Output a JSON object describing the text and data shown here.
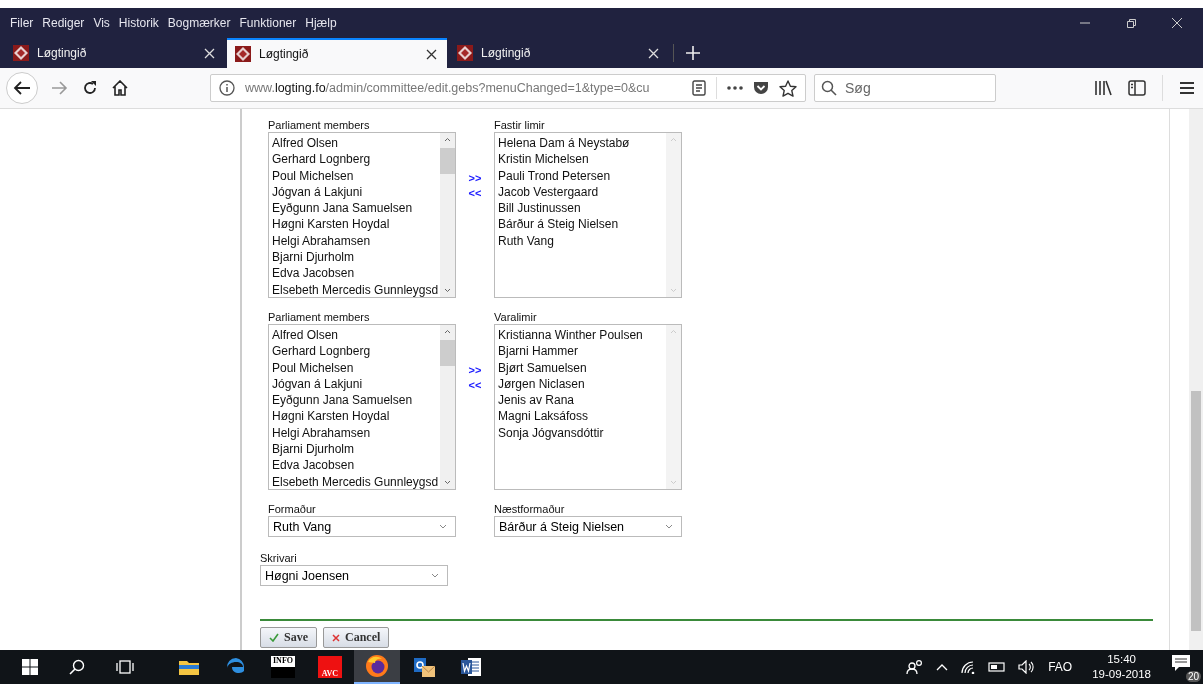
{
  "menu_bar": [
    "Filer",
    "Rediger",
    "Vis",
    "Historik",
    "Bogmærker",
    "Funktioner",
    "Hjælp"
  ],
  "tabs": [
    {
      "title": "Løgtingið",
      "selected": false
    },
    {
      "title": "Løgtingið",
      "selected": true
    },
    {
      "title": "Løgtingið",
      "selected": false
    }
  ],
  "address_bar": {
    "prefix": "www.",
    "domain": "logting.fo",
    "path": "/admin/committee/edit.gebs?menuChanged=1&type=0&cu"
  },
  "search": {
    "placeholder": "Søg"
  },
  "member_groups": [
    {
      "source_label": "Parliament members",
      "source_items": [
        "Alfred Olsen",
        "Gerhard Lognberg",
        "Poul Michelsen",
        "Jógvan á Lakjuni",
        "Eyðgunn Jana Samuelsen",
        "Høgni Karsten Hoydal",
        "Helgi Abrahamsen",
        "Bjarni Djurholm",
        "Edva Jacobsen",
        "Elsebeth Mercedis Gunnleygsd"
      ],
      "move_right": ">>",
      "move_left": "<<",
      "target_label": "Fastir limir",
      "target_items": [
        "Helena Dam á Neystabø",
        "Kristin Michelsen",
        "Pauli Trond Petersen",
        "Jacob Vestergaard",
        "Bill Justinussen",
        "Bárður á Steig Nielsen",
        "Ruth Vang"
      ]
    },
    {
      "source_label": "Parliament members",
      "source_items": [
        "Alfred Olsen",
        "Gerhard Lognberg",
        "Poul Michelsen",
        "Jógvan á Lakjuni",
        "Eyðgunn Jana Samuelsen",
        "Høgni Karsten Hoydal",
        "Helgi Abrahamsen",
        "Bjarni Djurholm",
        "Edva Jacobsen",
        "Elsebeth Mercedis Gunnleygsd"
      ],
      "move_right": ">>",
      "move_left": "<<",
      "target_label": "Varalimir",
      "target_items": [
        "Kristianna Winther Poulsen",
        "Bjarni Hammer",
        "Bjørt Samuelsen",
        "Jørgen Niclasen",
        "Jenis av Rana",
        "Magni Laksáfoss",
        "Sonja Jógvansdóttir"
      ]
    }
  ],
  "officer_selects": [
    {
      "label": "Formaður",
      "value": "Ruth Vang"
    },
    {
      "label": "Næstformaður",
      "value": "Bárður á Steig Nielsen"
    }
  ],
  "secretary_select": {
    "label": "Skrivari",
    "value": "Høgni Joensen"
  },
  "buttons": [
    {
      "kind": "save",
      "label": "Save"
    },
    {
      "kind": "cancel",
      "label": "Cancel"
    }
  ],
  "taskbar": {
    "apps": [
      {
        "kind": "explorer",
        "active": false
      },
      {
        "kind": "edge",
        "active": false
      },
      {
        "kind": "info",
        "label": "INFO",
        "active": false
      },
      {
        "kind": "avc",
        "label": "AVC",
        "active": false
      },
      {
        "kind": "firefox",
        "active": true
      },
      {
        "kind": "outlook",
        "active": false
      },
      {
        "kind": "word",
        "active": false
      }
    ],
    "language": "FAO",
    "time": "15:40",
    "date": "19-09-2018",
    "notification_count": "20"
  }
}
